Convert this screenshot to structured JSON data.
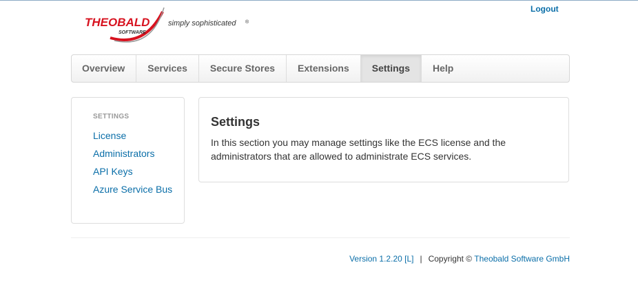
{
  "header": {
    "logout_label": "Logout",
    "logo": {
      "brand": "THEOBALD",
      "sub": "SOFTWARE",
      "tagline": "simply sophisticated",
      "mark": "®"
    }
  },
  "nav": {
    "items": [
      {
        "label": "Overview"
      },
      {
        "label": "Services"
      },
      {
        "label": "Secure Stores"
      },
      {
        "label": "Extensions"
      },
      {
        "label": "Settings",
        "active": true
      },
      {
        "label": "Help"
      }
    ]
  },
  "sidebar": {
    "header": "SETTINGS",
    "links": [
      {
        "label": "License"
      },
      {
        "label": "Administrators"
      },
      {
        "label": "API Keys"
      },
      {
        "label": "Azure Service Bus"
      }
    ]
  },
  "main": {
    "title": "Settings",
    "description": "In this section you may manage settings like the ECS license and the administrators that are allowed to administrate ECS services."
  },
  "footer": {
    "version": "Version 1.2.20 [L]",
    "separator": "|",
    "copyright": "Copyright ©",
    "company": "Theobald Software GmbH"
  },
  "colors": {
    "link": "#0a6ea8",
    "brand_red": "#d7121f"
  }
}
